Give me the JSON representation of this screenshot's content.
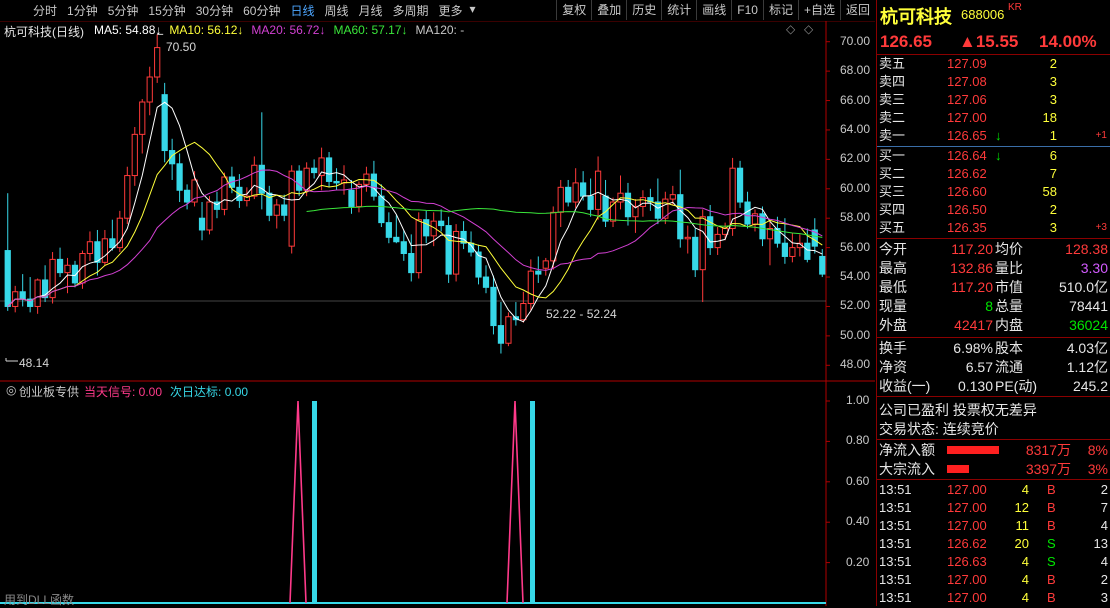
{
  "toolbar": {
    "tabs": [
      "分时",
      "1分钟",
      "5分钟",
      "15分钟",
      "30分钟",
      "60分钟",
      "日线",
      "周线",
      "月线",
      "多周期",
      "更多"
    ],
    "active_tab": "日线",
    "right_buttons": [
      "复权",
      "叠加",
      "历史",
      "统计",
      "画线",
      "F10",
      "标记",
      "+自选",
      "返回"
    ]
  },
  "chart": {
    "title": "杭可科技(日线)",
    "ma_labels": [
      {
        "text": "MA5: 54.88",
        "arrow": "↓",
        "color": "#ffffff"
      },
      {
        "text": "MA10: 56.12",
        "arrow": "↓",
        "color": "#ffff3a"
      },
      {
        "text": "MA20: 56.72",
        "arrow": "↓",
        "color": "#d240d2"
      },
      {
        "text": "MA60: 57.17",
        "arrow": "↓",
        "color": "#3ae63a"
      },
      {
        "text": "MA120: -",
        "arrow": "",
        "color": "#c8c8c8"
      }
    ],
    "high_marker": "70.50",
    "low_marker": "48.14",
    "range_label": "52.22 - 52.24",
    "price_ticks": [
      "70.00",
      "68.00",
      "66.00",
      "64.00",
      "62.00",
      "60.00",
      "58.00",
      "56.00",
      "54.00",
      "52.00",
      "50.00",
      "48.00"
    ],
    "indicator_title": "创业板专供",
    "indicator_series": [
      {
        "text": "当天信号: 0.00",
        "color": "#ff3a8a"
      },
      {
        "text": "次日达标: 0.00",
        "color": "#37d8e8"
      }
    ],
    "indicator_ticks": [
      "1.00",
      "0.80",
      "0.60",
      "0.40",
      "0.20"
    ],
    "footer_note": "用到DLL函数",
    "colors": {
      "up": "#ff3a3a",
      "down": "#37d8e8",
      "ma5": "#ffffff",
      "ma10": "#ffff3a",
      "ma20": "#d240d2",
      "ma60": "#3ae63a",
      "axis": "#b00000"
    }
  },
  "quote": {
    "name": "杭可科技",
    "code": "688006",
    "tag": "KR",
    "price": "126.65",
    "change": "▲15.55",
    "change_pct": "14.00%",
    "asks": [
      {
        "label": "卖五",
        "price": "127.09",
        "vol": "2",
        "extra": ""
      },
      {
        "label": "卖四",
        "price": "127.08",
        "vol": "3",
        "extra": ""
      },
      {
        "label": "卖三",
        "price": "127.06",
        "vol": "3",
        "extra": ""
      },
      {
        "label": "卖二",
        "price": "127.00",
        "vol": "18",
        "extra": ""
      },
      {
        "label": "卖一",
        "price": "126.65",
        "vol": "1",
        "extra": "+1"
      }
    ],
    "bids": [
      {
        "label": "买一",
        "price": "126.64",
        "vol": "6",
        "extra": ""
      },
      {
        "label": "买二",
        "price": "126.62",
        "vol": "7",
        "extra": ""
      },
      {
        "label": "买三",
        "price": "126.60",
        "vol": "58",
        "extra": ""
      },
      {
        "label": "买四",
        "price": "126.50",
        "vol": "2",
        "extra": ""
      },
      {
        "label": "买五",
        "price": "126.35",
        "vol": "3",
        "extra": "+3"
      }
    ],
    "stats1": [
      {
        "l1": "今开",
        "v1": "117.20",
        "c1": "red",
        "l2": "均价",
        "v2": "128.38",
        "c2": "red"
      },
      {
        "l1": "最高",
        "v1": "132.86",
        "c1": "red",
        "l2": "量比",
        "v2": "3.30",
        "c2": "magenta"
      },
      {
        "l1": "最低",
        "v1": "117.20",
        "c1": "red",
        "l2": "市值",
        "v2": "510.0亿",
        "c2": "white"
      },
      {
        "l1": "现量",
        "v1": "8",
        "c1": "green",
        "l2": "总量",
        "v2": "78441",
        "c2": "white"
      },
      {
        "l1": "外盘",
        "v1": "42417",
        "c1": "red",
        "l2": "内盘",
        "v2": "36024",
        "c2": "green"
      }
    ],
    "stats2": [
      {
        "l1": "换手",
        "v1": "6.98%",
        "l2": "股本",
        "v2": "4.03亿"
      },
      {
        "l1": "净资",
        "v1": "6.57",
        "l2": "流通",
        "v2": "1.12亿"
      },
      {
        "l1": "收益(一)",
        "v1": "0.130",
        "l2": "PE(动)",
        "v2": "245.2"
      }
    ],
    "info1": "公司已盈利 投票权无差异",
    "info2": "交易状态: 连续竞价",
    "flows": [
      {
        "label": "净流入额",
        "value": "8317万",
        "pct": "8%",
        "bar": 0.65
      },
      {
        "label": "大宗流入",
        "value": "3397万",
        "pct": "3%",
        "bar": 0.27
      }
    ],
    "ticks": [
      {
        "time": "13:51",
        "price": "127.00",
        "vol": "4",
        "side": "B",
        "n": "2"
      },
      {
        "time": "13:51",
        "price": "127.00",
        "vol": "12",
        "side": "B",
        "n": "7"
      },
      {
        "time": "13:51",
        "price": "127.00",
        "vol": "11",
        "side": "B",
        "n": "4"
      },
      {
        "time": "13:51",
        "price": "126.62",
        "vol": "20",
        "side": "S",
        "n": "13"
      },
      {
        "time": "13:51",
        "price": "126.63",
        "vol": "4",
        "side": "S",
        "n": "4"
      },
      {
        "time": "13:51",
        "price": "127.00",
        "vol": "4",
        "side": "B",
        "n": "2"
      },
      {
        "time": "13:51",
        "price": "127.00",
        "vol": "4",
        "side": "B",
        "n": "3"
      }
    ]
  },
  "chart_data": {
    "type": "candlestick",
    "title": "杭可科技(日线)",
    "ylim": [
      47,
      71
    ],
    "candles": [
      [
        55.8,
        59.7,
        51.7,
        52.0
      ],
      [
        52.0,
        53.4,
        51.6,
        53.0
      ],
      [
        53.0,
        54.2,
        52.0,
        52.5
      ],
      [
        52.5,
        54.0,
        51.6,
        52.0
      ],
      [
        52.0,
        53.9,
        51.5,
        53.8
      ],
      [
        53.8,
        54.8,
        52.3,
        52.6
      ],
      [
        52.6,
        55.7,
        52.2,
        55.2
      ],
      [
        55.2,
        56.0,
        54.0,
        54.3
      ],
      [
        54.3,
        55.3,
        52.9,
        54.8
      ],
      [
        54.8,
        55.1,
        53.3,
        53.6
      ],
      [
        53.6,
        55.8,
        53.2,
        55.6
      ],
      [
        55.6,
        57.1,
        55.1,
        56.4
      ],
      [
        56.4,
        57.2,
        54.1,
        55.0
      ],
      [
        55.0,
        57.2,
        54.8,
        56.6
      ],
      [
        56.6,
        57.9,
        55.8,
        56.0
      ],
      [
        56.0,
        58.5,
        55.7,
        58.0
      ],
      [
        58.0,
        61.5,
        57.6,
        60.9
      ],
      [
        60.9,
        64.2,
        60.2,
        63.7
      ],
      [
        63.7,
        66.1,
        62.4,
        65.9
      ],
      [
        65.9,
        68.3,
        65.0,
        67.6
      ],
      [
        67.6,
        70.5,
        67.2,
        69.6
      ],
      [
        66.4,
        67.2,
        61.8,
        62.6
      ],
      [
        62.6,
        63.4,
        60.6,
        61.7
      ],
      [
        61.7,
        62.4,
        59.1,
        59.9
      ],
      [
        59.9,
        60.3,
        58.6,
        59.1
      ],
      [
        59.1,
        61.2,
        58.8,
        60.6
      ],
      [
        58.0,
        59.1,
        56.5,
        57.2
      ],
      [
        57.2,
        59.5,
        56.9,
        59.1
      ],
      [
        59.1,
        59.8,
        58.0,
        58.6
      ],
      [
        58.6,
        61.1,
        58.2,
        60.8
      ],
      [
        60.8,
        61.5,
        59.7,
        60.1
      ],
      [
        60.1,
        61.0,
        58.7,
        59.2
      ],
      [
        59.2,
        60.1,
        58.8,
        59.5
      ],
      [
        59.5,
        62.2,
        59.3,
        61.6
      ],
      [
        61.6,
        65.2,
        58.6,
        59.7
      ],
      [
        59.7,
        60.2,
        57.8,
        58.2
      ],
      [
        58.2,
        59.3,
        57.3,
        58.9
      ],
      [
        58.9,
        59.6,
        57.8,
        58.2
      ],
      [
        56.1,
        61.6,
        55.6,
        61.2
      ],
      [
        61.2,
        61.6,
        59.5,
        59.9
      ],
      [
        59.9,
        61.8,
        59.5,
        61.4
      ],
      [
        61.4,
        62.0,
        60.7,
        61.1
      ],
      [
        60.9,
        62.8,
        59.9,
        62.1
      ],
      [
        62.1,
        62.5,
        60.1,
        60.5
      ],
      [
        60.5,
        61.4,
        59.9,
        60.4
      ],
      [
        60.4,
        61.6,
        59.6,
        60.6
      ],
      [
        59.9,
        60.6,
        58.3,
        58.8
      ],
      [
        58.8,
        60.5,
        58.4,
        60.3
      ],
      [
        60.3,
        61.5,
        59.8,
        61.0
      ],
      [
        61.0,
        61.9,
        59.2,
        59.5
      ],
      [
        59.5,
        60.3,
        57.4,
        57.7
      ],
      [
        57.7,
        58.4,
        56.3,
        56.7
      ],
      [
        56.7,
        58.2,
        56.3,
        56.4
      ],
      [
        56.4,
        57.2,
        55.1,
        55.6
      ],
      [
        55.6,
        56.9,
        53.7,
        54.3
      ],
      [
        54.3,
        58.4,
        53.9,
        57.9
      ],
      [
        57.9,
        58.5,
        56.3,
        56.8
      ],
      [
        56.8,
        58.4,
        56.1,
        57.8
      ],
      [
        57.8,
        58.6,
        57.1,
        57.5
      ],
      [
        57.5,
        58.1,
        53.6,
        54.2
      ],
      [
        54.2,
        57.6,
        53.7,
        57.1
      ],
      [
        57.1,
        57.8,
        55.9,
        56.3
      ],
      [
        56.3,
        57.1,
        55.4,
        55.7
      ],
      [
        55.7,
        56.2,
        53.5,
        54.0
      ],
      [
        54.0,
        54.8,
        52.9,
        53.3
      ],
      [
        53.3,
        54.1,
        50.1,
        50.7
      ],
      [
        50.7,
        52.3,
        48.8,
        49.5
      ],
      [
        49.5,
        51.6,
        49.3,
        51.3
      ],
      [
        51.3,
        52.3,
        50.7,
        51.1
      ],
      [
        51.1,
        53.0,
        50.9,
        52.2
      ],
      [
        52.2,
        55.2,
        51.7,
        54.4
      ],
      [
        54.4,
        55.4,
        53.6,
        54.2
      ],
      [
        54.6,
        55.3,
        54.1,
        55.1
      ],
      [
        55.1,
        58.8,
        54.5,
        58.4
      ],
      [
        58.4,
        60.6,
        57.4,
        60.1
      ],
      [
        60.1,
        60.6,
        58.8,
        59.1
      ],
      [
        59.1,
        61.4,
        58.7,
        60.4
      ],
      [
        60.4,
        61.2,
        59.2,
        59.5
      ],
      [
        59.5,
        60.7,
        58.1,
        58.6
      ],
      [
        58.6,
        62.2,
        57.9,
        61.2
      ],
      [
        59.5,
        60.6,
        57.4,
        57.8
      ],
      [
        57.8,
        59.4,
        57.4,
        59.1
      ],
      [
        59.1,
        60.9,
        58.6,
        59.7
      ],
      [
        59.7,
        60.4,
        57.5,
        58.1
      ],
      [
        58.1,
        59.3,
        57.0,
        58.8
      ],
      [
        58.8,
        59.9,
        58.1,
        59.4
      ],
      [
        59.4,
        60.0,
        58.5,
        59.1
      ],
      [
        59.1,
        60.7,
        57.6,
        58.0
      ],
      [
        58.0,
        59.8,
        57.6,
        59.3
      ],
      [
        59.3,
        60.2,
        58.9,
        59.6
      ],
      [
        59.6,
        61.3,
        56.0,
        56.6
      ],
      [
        56.6,
        57.5,
        55.6,
        56.7
      ],
      [
        56.7,
        57.3,
        54.0,
        54.5
      ],
      [
        54.5,
        58.6,
        52.3,
        58.1
      ],
      [
        58.1,
        58.9,
        55.5,
        56.0
      ],
      [
        56.0,
        57.4,
        55.5,
        56.9
      ],
      [
        56.9,
        57.7,
        56.5,
        57.3
      ],
      [
        57.3,
        62.1,
        56.8,
        61.4
      ],
      [
        61.4,
        61.9,
        58.7,
        59.1
      ],
      [
        59.1,
        59.8,
        57.3,
        57.6
      ],
      [
        57.6,
        58.6,
        57.1,
        58.3
      ],
      [
        58.3,
        58.8,
        56.1,
        56.6
      ],
      [
        56.6,
        57.8,
        54.8,
        57.3
      ],
      [
        57.3,
        58.1,
        56.0,
        56.3
      ],
      [
        56.3,
        58.0,
        54.9,
        55.4
      ],
      [
        55.4,
        57.0,
        55.0,
        56.0
      ],
      [
        56.0,
        56.9,
        55.4,
        56.3
      ],
      [
        56.3,
        57.3,
        55.0,
        55.2
      ],
      [
        57.2,
        58.0,
        55.6,
        56.1
      ],
      [
        55.4,
        55.9,
        54.0,
        54.2
      ]
    ],
    "signal_bars": [
      {
        "index": 33,
        "value": 1.0
      },
      {
        "index": 76,
        "value": 1.0
      }
    ]
  }
}
